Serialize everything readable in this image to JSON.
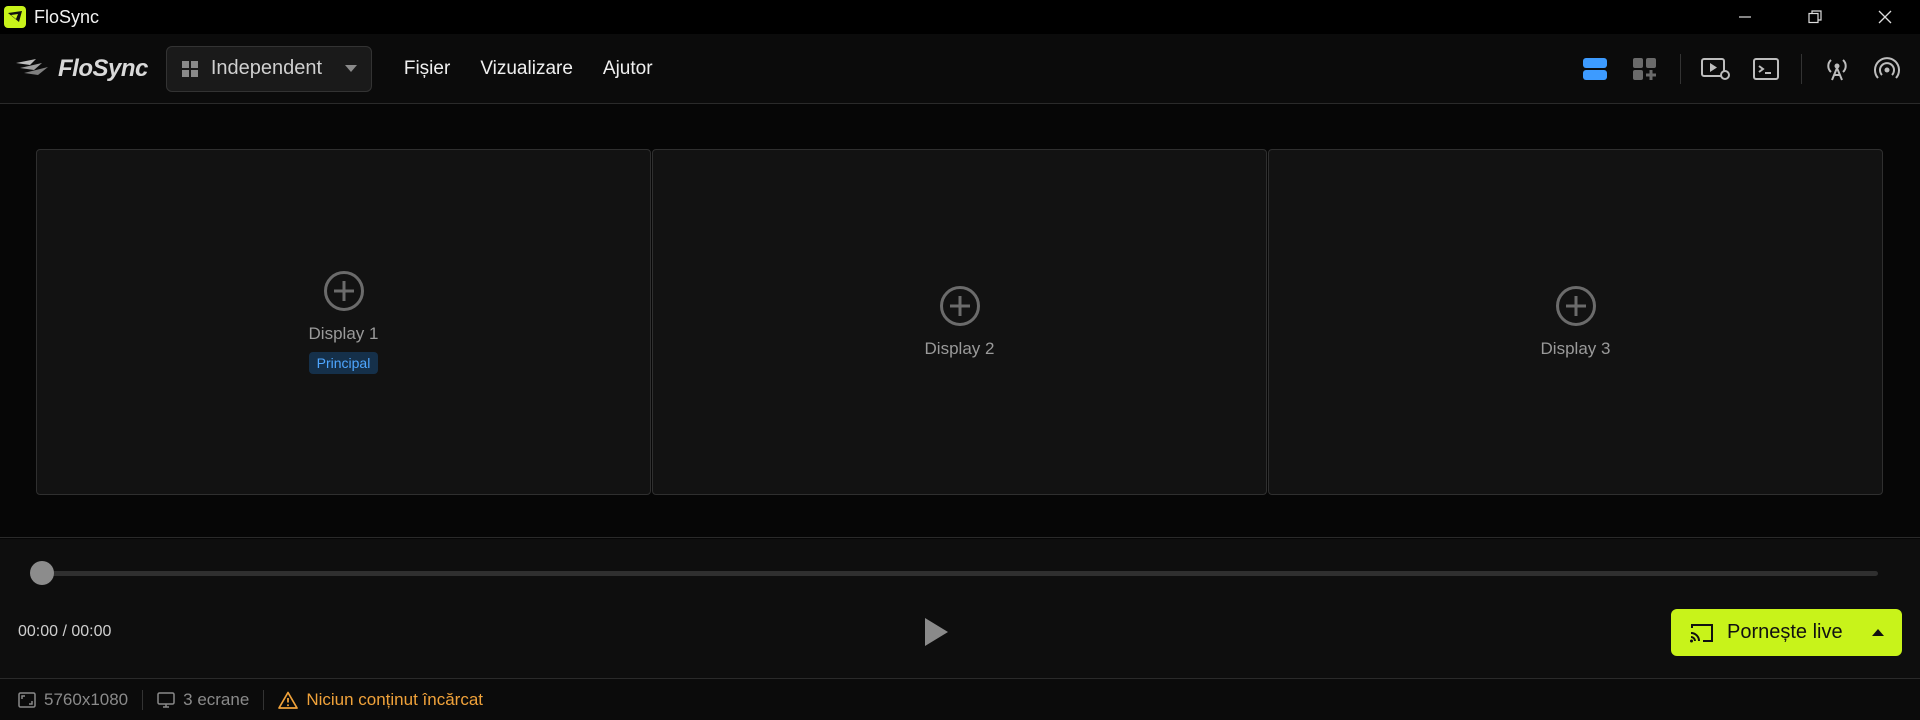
{
  "window": {
    "title": "FloSync"
  },
  "menubar": {
    "logo_text": "FloSync",
    "mode": "Independent",
    "menu": [
      "Fișier",
      "Vizualizare",
      "Ajutor"
    ]
  },
  "displays": [
    {
      "name": "Display 1",
      "badge": "Principal"
    },
    {
      "name": "Display 2"
    },
    {
      "name": "Display 3"
    }
  ],
  "playback": {
    "time": "00:00 / 00:00",
    "progress": 0,
    "live_label": "Pornește live"
  },
  "status": {
    "resolution": "5760x1080",
    "screens": "3 ecrane",
    "warning": "Niciun conținut încărcat"
  },
  "colors": {
    "accent": "#c8f31a",
    "active_icon": "#3d9bff",
    "warning": "#f0a23a"
  },
  "icons": {
    "layout_single": "layout-rows-icon",
    "layout_add": "layout-grid-add-icon",
    "preview_settings": "video-settings-icon",
    "terminal": "terminal-icon",
    "broadcast": "antenna-icon",
    "signal": "signal-icon"
  }
}
